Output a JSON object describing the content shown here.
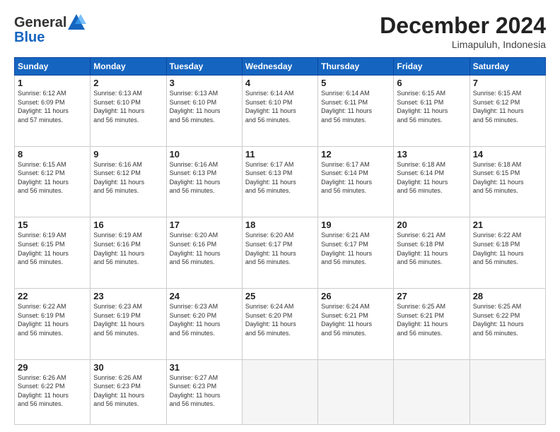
{
  "header": {
    "logo_line1": "General",
    "logo_line2": "Blue",
    "month": "December 2024",
    "location": "Limapuluh, Indonesia"
  },
  "weekdays": [
    "Sunday",
    "Monday",
    "Tuesday",
    "Wednesday",
    "Thursday",
    "Friday",
    "Saturday"
  ],
  "weeks": [
    [
      {
        "day": "1",
        "sunrise": "6:12 AM",
        "sunset": "6:09 PM",
        "daylight": "11 hours and 57 minutes."
      },
      {
        "day": "2",
        "sunrise": "6:13 AM",
        "sunset": "6:10 PM",
        "daylight": "11 hours and 56 minutes."
      },
      {
        "day": "3",
        "sunrise": "6:13 AM",
        "sunset": "6:10 PM",
        "daylight": "11 hours and 56 minutes."
      },
      {
        "day": "4",
        "sunrise": "6:14 AM",
        "sunset": "6:10 PM",
        "daylight": "11 hours and 56 minutes."
      },
      {
        "day": "5",
        "sunrise": "6:14 AM",
        "sunset": "6:11 PM",
        "daylight": "11 hours and 56 minutes."
      },
      {
        "day": "6",
        "sunrise": "6:15 AM",
        "sunset": "6:11 PM",
        "daylight": "11 hours and 56 minutes."
      },
      {
        "day": "7",
        "sunrise": "6:15 AM",
        "sunset": "6:12 PM",
        "daylight": "11 hours and 56 minutes."
      }
    ],
    [
      {
        "day": "8",
        "sunrise": "6:15 AM",
        "sunset": "6:12 PM",
        "daylight": "11 hours and 56 minutes."
      },
      {
        "day": "9",
        "sunrise": "6:16 AM",
        "sunset": "6:12 PM",
        "daylight": "11 hours and 56 minutes."
      },
      {
        "day": "10",
        "sunrise": "6:16 AM",
        "sunset": "6:13 PM",
        "daylight": "11 hours and 56 minutes."
      },
      {
        "day": "11",
        "sunrise": "6:17 AM",
        "sunset": "6:13 PM",
        "daylight": "11 hours and 56 minutes."
      },
      {
        "day": "12",
        "sunrise": "6:17 AM",
        "sunset": "6:14 PM",
        "daylight": "11 hours and 56 minutes."
      },
      {
        "day": "13",
        "sunrise": "6:18 AM",
        "sunset": "6:14 PM",
        "daylight": "11 hours and 56 minutes."
      },
      {
        "day": "14",
        "sunrise": "6:18 AM",
        "sunset": "6:15 PM",
        "daylight": "11 hours and 56 minutes."
      }
    ],
    [
      {
        "day": "15",
        "sunrise": "6:19 AM",
        "sunset": "6:15 PM",
        "daylight": "11 hours and 56 minutes."
      },
      {
        "day": "16",
        "sunrise": "6:19 AM",
        "sunset": "6:16 PM",
        "daylight": "11 hours and 56 minutes."
      },
      {
        "day": "17",
        "sunrise": "6:20 AM",
        "sunset": "6:16 PM",
        "daylight": "11 hours and 56 minutes."
      },
      {
        "day": "18",
        "sunrise": "6:20 AM",
        "sunset": "6:17 PM",
        "daylight": "11 hours and 56 minutes."
      },
      {
        "day": "19",
        "sunrise": "6:21 AM",
        "sunset": "6:17 PM",
        "daylight": "11 hours and 56 minutes."
      },
      {
        "day": "20",
        "sunrise": "6:21 AM",
        "sunset": "6:18 PM",
        "daylight": "11 hours and 56 minutes."
      },
      {
        "day": "21",
        "sunrise": "6:22 AM",
        "sunset": "6:18 PM",
        "daylight": "11 hours and 56 minutes."
      }
    ],
    [
      {
        "day": "22",
        "sunrise": "6:22 AM",
        "sunset": "6:19 PM",
        "daylight": "11 hours and 56 minutes."
      },
      {
        "day": "23",
        "sunrise": "6:23 AM",
        "sunset": "6:19 PM",
        "daylight": "11 hours and 56 minutes."
      },
      {
        "day": "24",
        "sunrise": "6:23 AM",
        "sunset": "6:20 PM",
        "daylight": "11 hours and 56 minutes."
      },
      {
        "day": "25",
        "sunrise": "6:24 AM",
        "sunset": "6:20 PM",
        "daylight": "11 hours and 56 minutes."
      },
      {
        "day": "26",
        "sunrise": "6:24 AM",
        "sunset": "6:21 PM",
        "daylight": "11 hours and 56 minutes."
      },
      {
        "day": "27",
        "sunrise": "6:25 AM",
        "sunset": "6:21 PM",
        "daylight": "11 hours and 56 minutes."
      },
      {
        "day": "28",
        "sunrise": "6:25 AM",
        "sunset": "6:22 PM",
        "daylight": "11 hours and 56 minutes."
      }
    ],
    [
      {
        "day": "29",
        "sunrise": "6:26 AM",
        "sunset": "6:22 PM",
        "daylight": "11 hours and 56 minutes."
      },
      {
        "day": "30",
        "sunrise": "6:26 AM",
        "sunset": "6:23 PM",
        "daylight": "11 hours and 56 minutes."
      },
      {
        "day": "31",
        "sunrise": "6:27 AM",
        "sunset": "6:23 PM",
        "daylight": "11 hours and 56 minutes."
      },
      null,
      null,
      null,
      null
    ]
  ]
}
